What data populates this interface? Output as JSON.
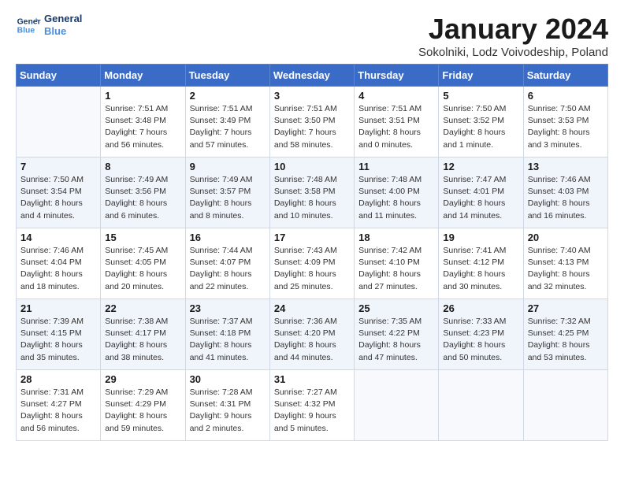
{
  "logo": {
    "text1": "General",
    "text2": "Blue"
  },
  "title": "January 2024",
  "subtitle": "Sokolniki, Lodz Voivodeship, Poland",
  "weekdays": [
    "Sunday",
    "Monday",
    "Tuesday",
    "Wednesday",
    "Thursday",
    "Friday",
    "Saturday"
  ],
  "weeks": [
    [
      {
        "day": "",
        "info": ""
      },
      {
        "day": "1",
        "info": "Sunrise: 7:51 AM\nSunset: 3:48 PM\nDaylight: 7 hours\nand 56 minutes."
      },
      {
        "day": "2",
        "info": "Sunrise: 7:51 AM\nSunset: 3:49 PM\nDaylight: 7 hours\nand 57 minutes."
      },
      {
        "day": "3",
        "info": "Sunrise: 7:51 AM\nSunset: 3:50 PM\nDaylight: 7 hours\nand 58 minutes."
      },
      {
        "day": "4",
        "info": "Sunrise: 7:51 AM\nSunset: 3:51 PM\nDaylight: 8 hours\nand 0 minutes."
      },
      {
        "day": "5",
        "info": "Sunrise: 7:50 AM\nSunset: 3:52 PM\nDaylight: 8 hours\nand 1 minute."
      },
      {
        "day": "6",
        "info": "Sunrise: 7:50 AM\nSunset: 3:53 PM\nDaylight: 8 hours\nand 3 minutes."
      }
    ],
    [
      {
        "day": "7",
        "info": "Sunrise: 7:50 AM\nSunset: 3:54 PM\nDaylight: 8 hours\nand 4 minutes."
      },
      {
        "day": "8",
        "info": "Sunrise: 7:49 AM\nSunset: 3:56 PM\nDaylight: 8 hours\nand 6 minutes."
      },
      {
        "day": "9",
        "info": "Sunrise: 7:49 AM\nSunset: 3:57 PM\nDaylight: 8 hours\nand 8 minutes."
      },
      {
        "day": "10",
        "info": "Sunrise: 7:48 AM\nSunset: 3:58 PM\nDaylight: 8 hours\nand 10 minutes."
      },
      {
        "day": "11",
        "info": "Sunrise: 7:48 AM\nSunset: 4:00 PM\nDaylight: 8 hours\nand 11 minutes."
      },
      {
        "day": "12",
        "info": "Sunrise: 7:47 AM\nSunset: 4:01 PM\nDaylight: 8 hours\nand 14 minutes."
      },
      {
        "day": "13",
        "info": "Sunrise: 7:46 AM\nSunset: 4:03 PM\nDaylight: 8 hours\nand 16 minutes."
      }
    ],
    [
      {
        "day": "14",
        "info": "Sunrise: 7:46 AM\nSunset: 4:04 PM\nDaylight: 8 hours\nand 18 minutes."
      },
      {
        "day": "15",
        "info": "Sunrise: 7:45 AM\nSunset: 4:05 PM\nDaylight: 8 hours\nand 20 minutes."
      },
      {
        "day": "16",
        "info": "Sunrise: 7:44 AM\nSunset: 4:07 PM\nDaylight: 8 hours\nand 22 minutes."
      },
      {
        "day": "17",
        "info": "Sunrise: 7:43 AM\nSunset: 4:09 PM\nDaylight: 8 hours\nand 25 minutes."
      },
      {
        "day": "18",
        "info": "Sunrise: 7:42 AM\nSunset: 4:10 PM\nDaylight: 8 hours\nand 27 minutes."
      },
      {
        "day": "19",
        "info": "Sunrise: 7:41 AM\nSunset: 4:12 PM\nDaylight: 8 hours\nand 30 minutes."
      },
      {
        "day": "20",
        "info": "Sunrise: 7:40 AM\nSunset: 4:13 PM\nDaylight: 8 hours\nand 32 minutes."
      }
    ],
    [
      {
        "day": "21",
        "info": "Sunrise: 7:39 AM\nSunset: 4:15 PM\nDaylight: 8 hours\nand 35 minutes."
      },
      {
        "day": "22",
        "info": "Sunrise: 7:38 AM\nSunset: 4:17 PM\nDaylight: 8 hours\nand 38 minutes."
      },
      {
        "day": "23",
        "info": "Sunrise: 7:37 AM\nSunset: 4:18 PM\nDaylight: 8 hours\nand 41 minutes."
      },
      {
        "day": "24",
        "info": "Sunrise: 7:36 AM\nSunset: 4:20 PM\nDaylight: 8 hours\nand 44 minutes."
      },
      {
        "day": "25",
        "info": "Sunrise: 7:35 AM\nSunset: 4:22 PM\nDaylight: 8 hours\nand 47 minutes."
      },
      {
        "day": "26",
        "info": "Sunrise: 7:33 AM\nSunset: 4:23 PM\nDaylight: 8 hours\nand 50 minutes."
      },
      {
        "day": "27",
        "info": "Sunrise: 7:32 AM\nSunset: 4:25 PM\nDaylight: 8 hours\nand 53 minutes."
      }
    ],
    [
      {
        "day": "28",
        "info": "Sunrise: 7:31 AM\nSunset: 4:27 PM\nDaylight: 8 hours\nand 56 minutes."
      },
      {
        "day": "29",
        "info": "Sunrise: 7:29 AM\nSunset: 4:29 PM\nDaylight: 8 hours\nand 59 minutes."
      },
      {
        "day": "30",
        "info": "Sunrise: 7:28 AM\nSunset: 4:31 PM\nDaylight: 9 hours\nand 2 minutes."
      },
      {
        "day": "31",
        "info": "Sunrise: 7:27 AM\nSunset: 4:32 PM\nDaylight: 9 hours\nand 5 minutes."
      },
      {
        "day": "",
        "info": ""
      },
      {
        "day": "",
        "info": ""
      },
      {
        "day": "",
        "info": ""
      }
    ]
  ]
}
